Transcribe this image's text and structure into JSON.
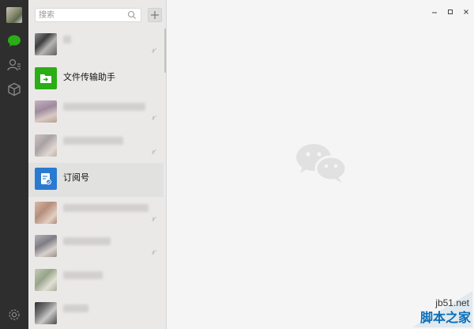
{
  "search": {
    "placeholder": "搜索"
  },
  "chats": [
    {
      "id": "blurred-1",
      "name": "",
      "muted": true
    },
    {
      "id": "file-helper",
      "name": "文件传输助手",
      "muted": false,
      "icon": "file-transfer-icon",
      "color": "#2bad15"
    },
    {
      "id": "blurred-2",
      "name": "",
      "muted": true
    },
    {
      "id": "blurred-3",
      "name": "",
      "muted": true
    },
    {
      "id": "subscriptions",
      "name": "订阅号",
      "muted": false,
      "icon": "subscription-icon",
      "color": "#2a7ad1"
    },
    {
      "id": "blurred-4",
      "name": "",
      "muted": true
    },
    {
      "id": "blurred-5",
      "name": "",
      "muted": true
    },
    {
      "id": "blurred-6",
      "name": "",
      "muted": false
    },
    {
      "id": "blurred-7",
      "name": "",
      "muted": false
    }
  ],
  "icons": {
    "nav": [
      "chat-icon",
      "contacts-icon",
      "favorites-icon",
      "settings-icon"
    ],
    "window": [
      "minimize-icon",
      "maximize-icon",
      "close-icon"
    ],
    "center": "wechat-logo-icon"
  },
  "colors": {
    "accent": "#2bad15",
    "sidebar": "#2e2e2e",
    "list_bg": "#ebe9e8",
    "selected_row": "#e1e1e0",
    "main_bg": "#f5f5f5"
  },
  "watermark": {
    "line1": "jb51.net",
    "line2": "脚本之家"
  }
}
